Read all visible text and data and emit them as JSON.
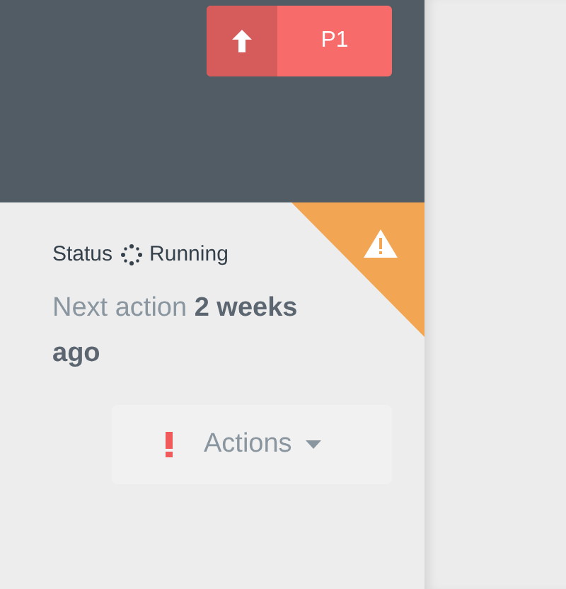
{
  "header": {
    "priority_button": {
      "label": "P1"
    }
  },
  "card": {
    "status": {
      "label": "Status",
      "value": "Running"
    },
    "next_action": "Next action **2 weeks ago**",
    "actions_button": {
      "label": "Actions"
    }
  }
}
